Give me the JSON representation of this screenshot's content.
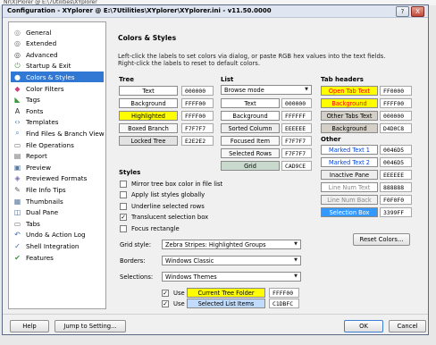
{
  "background_text": "Nr(X)Plorer @ E:\\7Utilities\\XYplorer",
  "window": {
    "title": "Configuration - XYplorer @ E:\\7Utilities\\XYplorer\\XYplorer.ini - v11.50.0000",
    "help_glyph": "?",
    "close_glyph": "X"
  },
  "sidebar": {
    "items": [
      {
        "label": "General",
        "icon": "general-icon",
        "color": "#888888"
      },
      {
        "label": "Extended",
        "icon": "extended-icon",
        "color": "#6a6a6a"
      },
      {
        "label": "Advanced",
        "icon": "advanced-icon",
        "color": "#4a4a4a"
      },
      {
        "label": "Startup & Exit",
        "icon": "power-icon",
        "color": "#4a9a3a"
      },
      {
        "label": "Colors & Styles",
        "icon": "palette-icon",
        "color": "#e0a030",
        "selected": true
      },
      {
        "label": "Color Filters",
        "icon": "color-filters-icon",
        "color": "#d04080"
      },
      {
        "label": "Tags",
        "icon": "tag-icon",
        "color": "#3a9a3a"
      },
      {
        "label": "Fonts",
        "icon": "font-icon",
        "color": "#333333"
      },
      {
        "label": "Templates",
        "icon": "templates-icon",
        "color": "#3a6ab0"
      },
      {
        "label": "Find Files & Branch View",
        "icon": "find-icon",
        "color": "#4a7ab8"
      },
      {
        "label": "File Operations",
        "icon": "file-operations-icon",
        "color": "#6a6a6a"
      },
      {
        "label": "Report",
        "icon": "report-icon",
        "color": "#6a6a6a"
      },
      {
        "label": "Preview",
        "icon": "preview-icon",
        "color": "#5a7aa0"
      },
      {
        "label": "Previewed Formats",
        "icon": "previewed-formats-icon",
        "color": "#7a6ab0"
      },
      {
        "label": "File Info Tips",
        "icon": "info-tips-icon",
        "color": "#5a5a5a"
      },
      {
        "label": "Thumbnails",
        "icon": "thumbnails-icon",
        "color": "#5a7aa0"
      },
      {
        "label": "Dual Pane",
        "icon": "dual-pane-icon",
        "color": "#4a6a9a"
      },
      {
        "label": "Tabs",
        "icon": "tabs-icon",
        "color": "#6a6a6a"
      },
      {
        "label": "Undo & Action Log",
        "icon": "undo-icon",
        "color": "#3a6ab0"
      },
      {
        "label": "Shell Integration",
        "icon": "shell-icon",
        "color": "#3a6ab0"
      },
      {
        "label": "Features",
        "icon": "features-icon",
        "color": "#3a9a3a"
      }
    ]
  },
  "panel": {
    "heading": "Colors & Styles",
    "description_line1": "Left-click the labels to set colors via dialog, or paste RGB hex values into the text fields.",
    "description_line2": "Right-click the labels to reset to default colors.",
    "tree": {
      "header": "Tree",
      "rows": [
        {
          "label": "Text",
          "hex": "000000",
          "bg": "#ffffff",
          "fg": "#000000"
        },
        {
          "label": "Background",
          "hex": "FFFF00",
          "bg": "#ffffff",
          "fg": "#000000"
        },
        {
          "label": "Highlighted",
          "hex": "FFFF00",
          "bg": "#ffff00",
          "fg": "#000000"
        },
        {
          "label": "Boxed Branch",
          "hex": "F7F7F7",
          "bg": "#f7f7f7",
          "fg": "#000000"
        },
        {
          "label": "Locked Tree",
          "hex": "E2E2E2",
          "bg": "#e2e2e2",
          "fg": "#000000"
        }
      ]
    },
    "list": {
      "header": "List",
      "mode_value": "Browse mode",
      "rows": [
        {
          "label": "Text",
          "hex": "000000",
          "bg": "#ffffff",
          "fg": "#000000"
        },
        {
          "label": "Background",
          "hex": "FFFFFF",
          "bg": "#ffffff",
          "fg": "#000000"
        },
        {
          "label": "Sorted Column",
          "hex": "EEEEEE",
          "bg": "#eeeeee",
          "fg": "#000000"
        },
        {
          "label": "Focused Item",
          "hex": "F7F7F7",
          "bg": "#f7f7f7",
          "fg": "#000000"
        },
        {
          "label": "Selected Rows",
          "hex": "F7F7F7",
          "bg": "#f7f7f7",
          "fg": "#000000"
        },
        {
          "label": "Grid",
          "hex": "CAD9CE",
          "bg": "#cad9ce",
          "fg": "#000000"
        }
      ]
    },
    "tab_headers": {
      "header": "Tab headers",
      "rows": [
        {
          "label": "Open Tab Text",
          "hex": "FF0000",
          "bg": "#ffff00",
          "fg": "#ff0000"
        },
        {
          "label": "Background",
          "hex": "FFFF00",
          "bg": "#ffff00",
          "fg": "#ff0000"
        },
        {
          "label": "Other Tabs Text",
          "hex": "000000",
          "bg": "#d4d0c8",
          "fg": "#000000"
        },
        {
          "label": "Background",
          "hex": "D4D0C8",
          "bg": "#d4d0c8",
          "fg": "#000000"
        }
      ]
    },
    "other": {
      "header": "Other",
      "rows": [
        {
          "label": "Marked Text 1",
          "hex": "0046D5",
          "bg": "#ffffff",
          "fg": "#0046d5"
        },
        {
          "label": "Marked Text 2",
          "hex": "0046D5",
          "bg": "#ffffff",
          "fg": "#0046d5"
        },
        {
          "label": "Inactive Pane",
          "hex": "EEEEEE",
          "bg": "#eeeeee",
          "fg": "#000000"
        },
        {
          "label": "Line Num Text",
          "hex": "888888",
          "bg": "#ffffff",
          "fg": "#888888"
        },
        {
          "label": "Line Num Back",
          "hex": "F0F0F0",
          "bg": "#f0f0f0",
          "fg": "#888888"
        },
        {
          "label": "Selection Box",
          "hex": "3399FF",
          "bg": "#3399ff",
          "fg": "#ffffff"
        }
      ]
    },
    "styles": {
      "header": "Styles",
      "checkboxes": [
        {
          "label": "Mirror tree box color in file list",
          "u": "x",
          "checked": false
        },
        {
          "label": "Apply list styles globally",
          "u": "",
          "checked": false
        },
        {
          "label": "Underline selected rows",
          "u": "w",
          "checked": false
        },
        {
          "label": "Translucent selection box",
          "u": "x",
          "checked": true
        },
        {
          "label": "Focus rectangle",
          "u": "c",
          "checked": false
        }
      ]
    },
    "grid_style": {
      "label": "Grid style:",
      "value": "Zebra Stripes: Highlighted Groups"
    },
    "borders": {
      "label": "Borders:",
      "value": "Windows Classic"
    },
    "selections": {
      "label": "Selections:",
      "value": "Windows Themes"
    },
    "use_rows": [
      {
        "use_label": "Use",
        "checked": true,
        "label": "Current Tree Folder",
        "hex": "FFFF00",
        "bg": "#ffff00",
        "fg": "#000000"
      },
      {
        "use_label": "Use",
        "checked": true,
        "label": "Selected List Items",
        "hex": "C1DBFC",
        "bg": "#c1dbfc",
        "fg": "#000000"
      }
    ],
    "reset_button": "Reset Colors..."
  },
  "footer": {
    "help": "Help",
    "jump": "Jump to Setting...",
    "ok": "OK",
    "cancel": "Cancel"
  },
  "colors": {
    "accent": "#3178d4",
    "title_bar": "#dfe6f1"
  }
}
